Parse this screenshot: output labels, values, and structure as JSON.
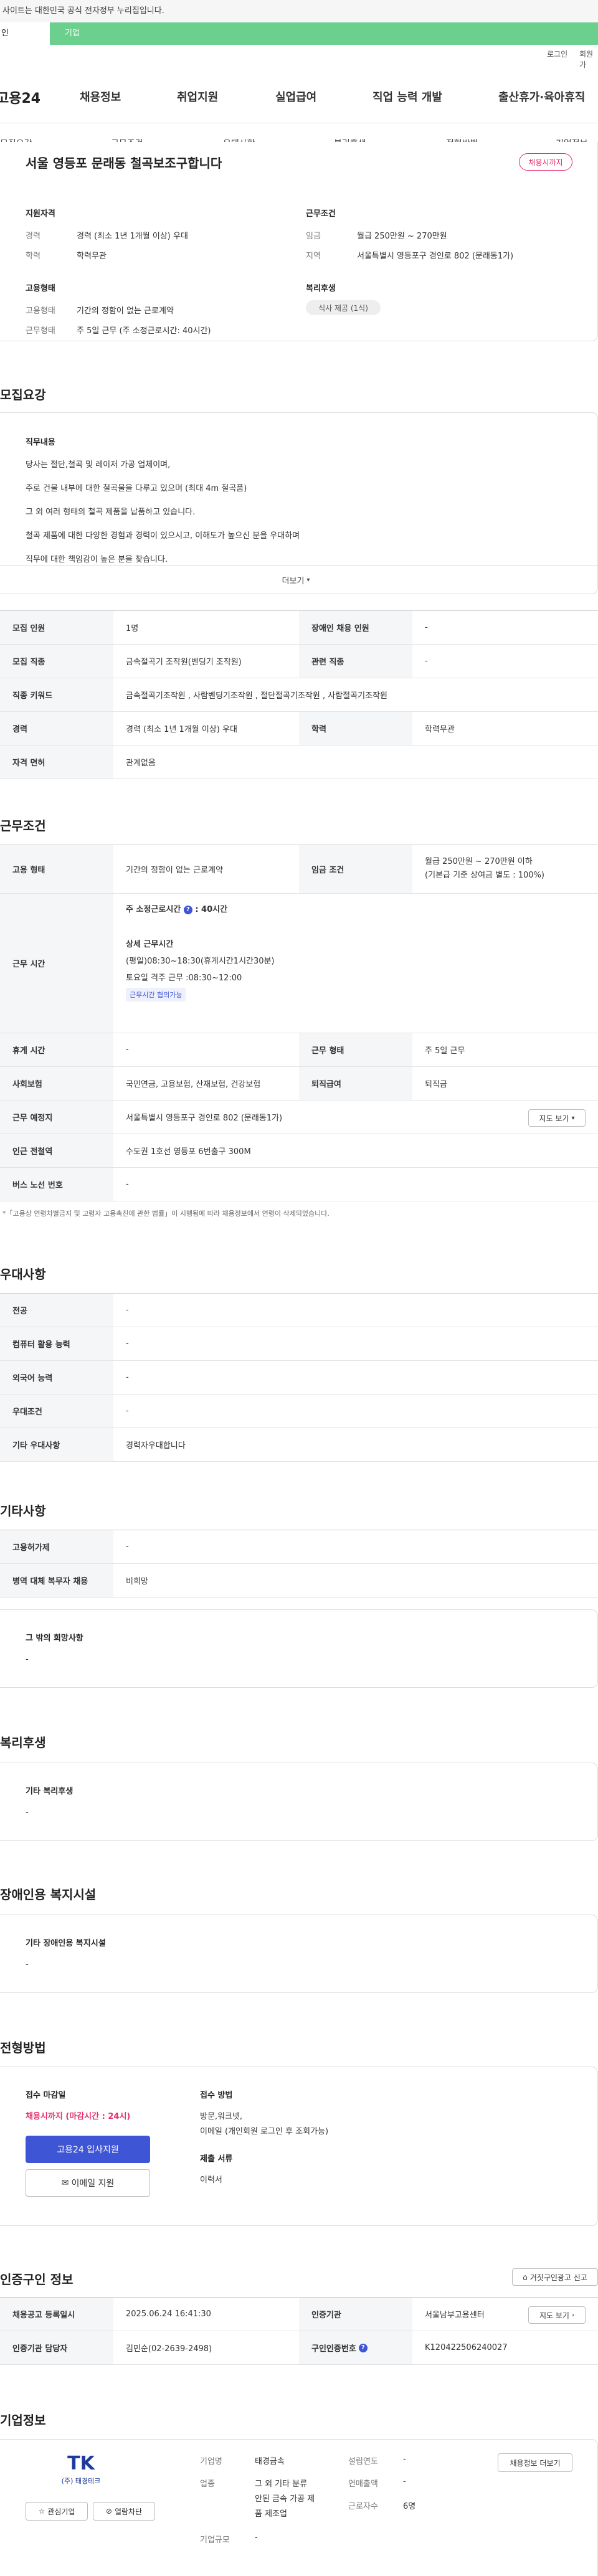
{
  "top": {
    "notice": "사이트는 대한민국 공식 전자정부 누리집입니다.",
    "tab_person": "인",
    "tab_company": "기업",
    "util_login": "로그인",
    "util_join": "회원가"
  },
  "gnb": {
    "logo": "고용24",
    "menu": [
      "채용정보",
      "취업지원",
      "실업급여",
      "직업 능력 개발",
      "출산휴가·육아휴직"
    ]
  },
  "subnav": [
    "모집요강",
    "근무조건",
    "우대사항",
    "복리후생",
    "전형방법",
    "기업정보"
  ],
  "summary": {
    "title": "서울 영등포 문래동 철곡보조구합니다",
    "badge": "채용시까지",
    "qual_title": "지원자격",
    "career_label": "경력",
    "career_value": "경력 (최소 1년 1개월 이상) 우대",
    "edu_label": "학력",
    "edu_value": "학력무관",
    "cond_title": "근무조건",
    "wage_label": "임금",
    "wage_value": "월급 250만원 ~ 270만원",
    "region_label": "지역",
    "region_value": "서울특별시 영등포구 경인로 802 (문래동1가)",
    "emp_title": "고용형태",
    "emp_label": "고용형태",
    "emp_value": "기간의 정함이 없는 근로계약",
    "work_label": "근무형태",
    "work_value": "주 5일 근무 (주 소정근로시간: 40시간)",
    "welfare_title": "복리후생",
    "welfare_chip": "식사 제공 (1식)"
  },
  "recruit": {
    "heading": "모집요강",
    "duty_title": "직무내용",
    "lines": [
      "당사는 절단,철곡 및 레이저 가공 업체이며,",
      "주로  건물 내부에 대한 철곡물을 다루고 있으며 (최대 4m 철곡품)",
      "그 외 여러 형태의 철곡 제품을 납품하고 있습니다.",
      "철곡 제품에 대한 다양한 경험과 경력이 있으시고,  이해도가 높으신 분을 우대하며",
      "직무에 대한 책임감이 높은 분을 찾습니다."
    ],
    "more": "더보기",
    "rows": [
      {
        "th": "모집 인원",
        "td": "1명",
        "th2": "장애인 채용 인원",
        "td2": "-"
      },
      {
        "th": "모집 직종",
        "td": "금속절곡기 조작원(벤딩기 조작원)",
        "th2": "관련 직종",
        "td2": "-"
      },
      {
        "th": "직종 키워드",
        "td": "금속절곡기조작원 , 사람벤딩기조작원 , 절단절곡기조작원 , 사람절곡기조작원",
        "th2": "",
        "td2": ""
      },
      {
        "th": "경력",
        "td": "경력 (최소 1년 1개월 이상) 우대",
        "th2": "학력",
        "td2": "학력무관"
      },
      {
        "th": "자격 면허",
        "td": "관계없음",
        "th2": "",
        "td2": ""
      }
    ]
  },
  "conditions": {
    "heading": "근무조건",
    "emp_type_th": "고용 형태",
    "emp_type_td": "기간의 정함이 없는 근로계약",
    "wage_th": "임금 조건",
    "wage_td1": "월급 250만원 ~ 270만원 이하",
    "wage_td2": "(기본급 기준 상여금 별도 : 100%)",
    "hours_th": "근무 시간",
    "hours_main": "주 소정근로시간",
    "hours_main_val": ": 40시간",
    "hours_detail_title": "상세 근무시간",
    "hours_detail_1": "(평일)08:30~18:30(휴게시간1시간30분)",
    "hours_detail_2": "토요일 격주 근무 :08:30~12:00",
    "hours_tag": "근무시간 협의가능",
    "rest_th": "휴게 시간",
    "rest_td": "-",
    "worktype_th": "근무 형태",
    "worktype_td": "주 5일 근무",
    "insurance_th": "사회보험",
    "insurance_td": "국민연금, 고용보험, 산재보험, 건강보험",
    "retire_th": "퇴직급여",
    "retire_td": "퇴직금",
    "place_th": "근무 예정지",
    "place_td": "서울특별시 영등포구 경인로 802 (문래동1가)",
    "map_btn": "지도 보기",
    "subway_th": "인근 전철역",
    "subway_td": "수도권 1호선 영등포 6번출구 300M",
    "bus_th": "버스 노선 번호",
    "bus_td": "-",
    "footnote": "*「고용상 연령차별금지 및 고령자 고용촉진에 관한 법률」이 시행됨에 따라 채용정보에서 연령이 삭제되었습니다."
  },
  "preference": {
    "heading": "우대사항",
    "rows": [
      {
        "th": "전공",
        "td": "-"
      },
      {
        "th": "컴퓨터 활용 능력",
        "td": "-"
      },
      {
        "th": "외국어 능력",
        "td": "-"
      },
      {
        "th": "우대조건",
        "td": "-"
      },
      {
        "th": "기타 우대사항",
        "td": "경력자우대합니다"
      }
    ]
  },
  "etc": {
    "heading": "기타사항",
    "rows": [
      {
        "th": "고용허가제",
        "td": "-"
      },
      {
        "th": "병역 대체 복무자 채용",
        "td": "비희망"
      }
    ],
    "other_title": "그 밖의 희망사항",
    "other_value": "-"
  },
  "welfare": {
    "heading": "복리후생",
    "title": "기타 복리후생",
    "value": "-"
  },
  "disability": {
    "heading": "장애인용 복지시설",
    "title": "기타 장애인용 복지시설",
    "value": "-"
  },
  "selection": {
    "heading": "전형방법",
    "deadline_title": "접수 마감일",
    "deadline_value": "채용시까지 (마감시간 : 24시)",
    "apply_btn": "고용24 입사지원",
    "email_btn": "이메일 지원",
    "method_title": "접수 방법",
    "method_value1": "방문,워크넷,",
    "method_value2": "이메일 (개인회원 로그인 후 조회가능)",
    "docs_title": "제출 서류",
    "docs_value": "이력서"
  },
  "cert": {
    "heading": "인증구인 정보",
    "report_btn": "거짓구인광고 신고",
    "reg_th": "채용공고 등록일시",
    "reg_td": "2025.06.24 16:41:30",
    "org_th": "인증기관",
    "org_td": "서울남부고용센터",
    "map_btn": "지도 보기",
    "manager_th": "인증기관 담당자",
    "manager_td": "김민순(02-2639-2498)",
    "job_no_th": "구인인증번호",
    "job_no_td": "K120422506240027"
  },
  "company": {
    "heading": "기업정보",
    "logo_big": "TK",
    "logo_name": "(주) 태경테크",
    "fav_btn": "관심기업",
    "block_btn": "열람차단",
    "more_btn": "채용정보 더보기",
    "name_label": "기업명",
    "name_value": "태경금속",
    "industry_label": "업종",
    "industry_value1": "그 외 기타 분류",
    "industry_value2": "안된 금속 가공 제",
    "industry_value3": "품 제조업",
    "scale_label": "기업규모",
    "scale_value": "-",
    "founded_label": "설립연도",
    "founded_value": "-",
    "sales_label": "연매출액",
    "sales_value": "-",
    "staff_label": "근로자수",
    "staff_value": "6명"
  },
  "colors": {
    "accent_green": "#6bd08e",
    "deadline_red": "#e3306a",
    "apply_blue": "#3e55d6"
  }
}
